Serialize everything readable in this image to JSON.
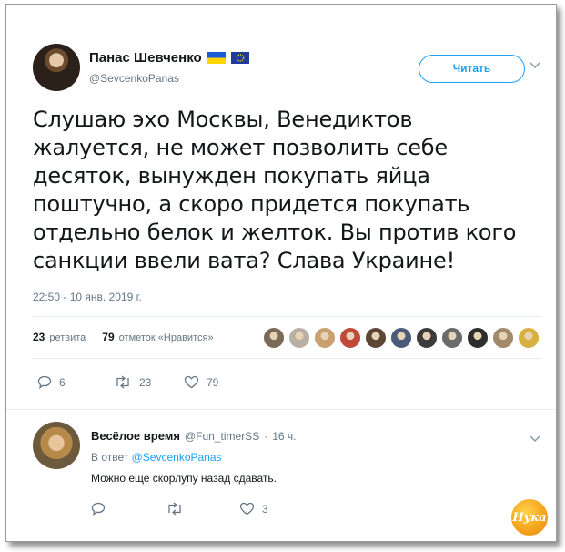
{
  "tweet": {
    "author_name": "Панас Шевченко",
    "author_handle": "@SevcenkoPanas",
    "follow_label": "Читать",
    "text": "Слушаю эхо Москвы, Венедиктов жалуется, не может позволить себе десяток, вынужден покупать яйца поштучно, а скоро придется покупать отдельно белок и желток. Вы против кого санкции ввели вата? Слава Украине!",
    "timestamp": "22:50 - 10 янв. 2019 г.",
    "retweets_count": "23",
    "retweets_label": "ретвита",
    "likes_count": "79",
    "likes_label": "отметок «Нравится»",
    "actions": {
      "replies": "6",
      "retweets": "23",
      "likes": "79"
    }
  },
  "reply": {
    "author_name": "Весёлое время",
    "author_handle": "@Fun_timerSS",
    "time": "16 ч.",
    "reply_to_prefix": "В ответ",
    "reply_to_handle": "@SevcenkoPanas",
    "text": "Можно еще скорлупу назад сдавать.",
    "actions": {
      "replies": "",
      "retweets": "",
      "likes": "3"
    }
  },
  "watermark": {
    "text": "Нука"
  },
  "colors": {
    "accent": "#1da1f2",
    "muted": "#657786",
    "liker_colors": [
      "#7a6a58",
      "#b8b0a4",
      "#caa070",
      "#c04a3a",
      "#5d4636",
      "#4a5a78",
      "#3b3b3b",
      "#6b6b6b",
      "#2d2d2d",
      "#a08a6a",
      "#d8b040"
    ]
  },
  "icons": [
    "chevron-down-icon",
    "reply-icon",
    "retweet-icon",
    "heart-icon",
    "ukraine-flag-icon",
    "eu-flag-icon"
  ]
}
